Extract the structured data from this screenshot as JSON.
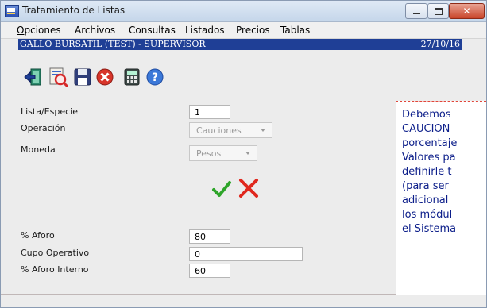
{
  "window": {
    "title": "Tratamiento de Listas"
  },
  "menu": [
    {
      "underline": "O",
      "rest": "pciones"
    },
    {
      "underline": "",
      "rest": "Archivos"
    },
    {
      "underline": "",
      "rest": "Consultas"
    },
    {
      "underline": "",
      "rest": "Listados"
    },
    {
      "underline": "",
      "rest": "Precios"
    },
    {
      "underline": "",
      "rest": "Tablas"
    }
  ],
  "infobar": {
    "left": "GALLO BURSATIL (TEST) - SUPERVISOR",
    "right": "27/10/16"
  },
  "toolbar": [
    "exit-door-icon",
    "search-document-icon",
    "save-disk-icon",
    "cancel-circle-icon",
    "calculator-icon",
    "help-icon"
  ],
  "form": {
    "lista_label": "Lista/Especie",
    "lista_value": "1",
    "operacion_label": "Operación",
    "operacion_value": "Cauciones",
    "moneda_label": "Moneda",
    "moneda_value": "Pesos",
    "aforo_label": "% Aforo",
    "aforo_value": "80",
    "cupo_label": "Cupo Operativo",
    "cupo_value": "0",
    "aforo_interno_label": "% Aforo Interno",
    "aforo_interno_value": "60"
  },
  "note": {
    "lines": [
      "Debemos",
      "CAUCION",
      "porcentaje",
      "Valores pa",
      "definirle t",
      "(para ser",
      "adicional",
      "los módul",
      "el Sistema"
    ]
  },
  "colors": {
    "accent_blue": "#1f3f96",
    "confirm_green": "#2ea52a",
    "cancel_red": "#e0281e",
    "note_text": "#0c1e8a",
    "note_border": "#e0463a"
  }
}
